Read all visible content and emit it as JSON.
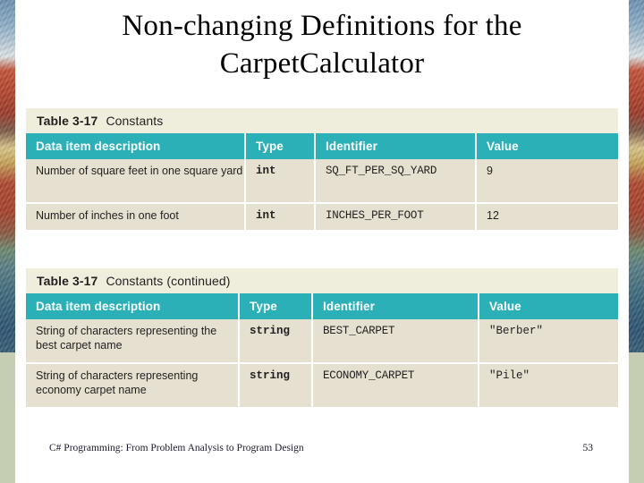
{
  "slide": {
    "title": "Non-changing Definitions for the CarpetCalculator",
    "colors": {
      "header_teal": "#2BB0B8",
      "row_beige": "#E6E0D0",
      "caption_band": "#EFEEDD",
      "keyword_blue": "#2F6FB5",
      "sage_edge": "#C5CDB3",
      "text": "#231F20"
    }
  },
  "tables": [
    {
      "caption_number": "Table 3-17",
      "caption_text": "Constants",
      "columns": [
        "Data item description",
        "Type",
        "Identifier",
        "Value"
      ],
      "rows": [
        {
          "description": "Number of square feet in one square yard",
          "type": "int",
          "identifier": "SQ_FT_PER_SQ_YARD",
          "value": "9"
        },
        {
          "description": "Number of inches in one foot",
          "type": "int",
          "identifier": "INCHES_PER_FOOT",
          "value": "12"
        }
      ]
    },
    {
      "caption_number": "Table 3-17",
      "caption_text": "Constants (continued)",
      "columns": [
        "Data item description",
        "Type",
        "Identifier",
        "Value"
      ],
      "rows": [
        {
          "description": "String of characters representing the best carpet name",
          "type": "string",
          "identifier": "BEST_CARPET",
          "value": "\"Berber\""
        },
        {
          "description": "String of characters representing economy carpet name",
          "type": "string",
          "identifier": "ECONOMY_CARPET",
          "value": "\"Pile\""
        }
      ]
    }
  ],
  "footer": {
    "book_title": "C# Programming: From Problem Analysis to Program Design",
    "page_number": "53"
  }
}
